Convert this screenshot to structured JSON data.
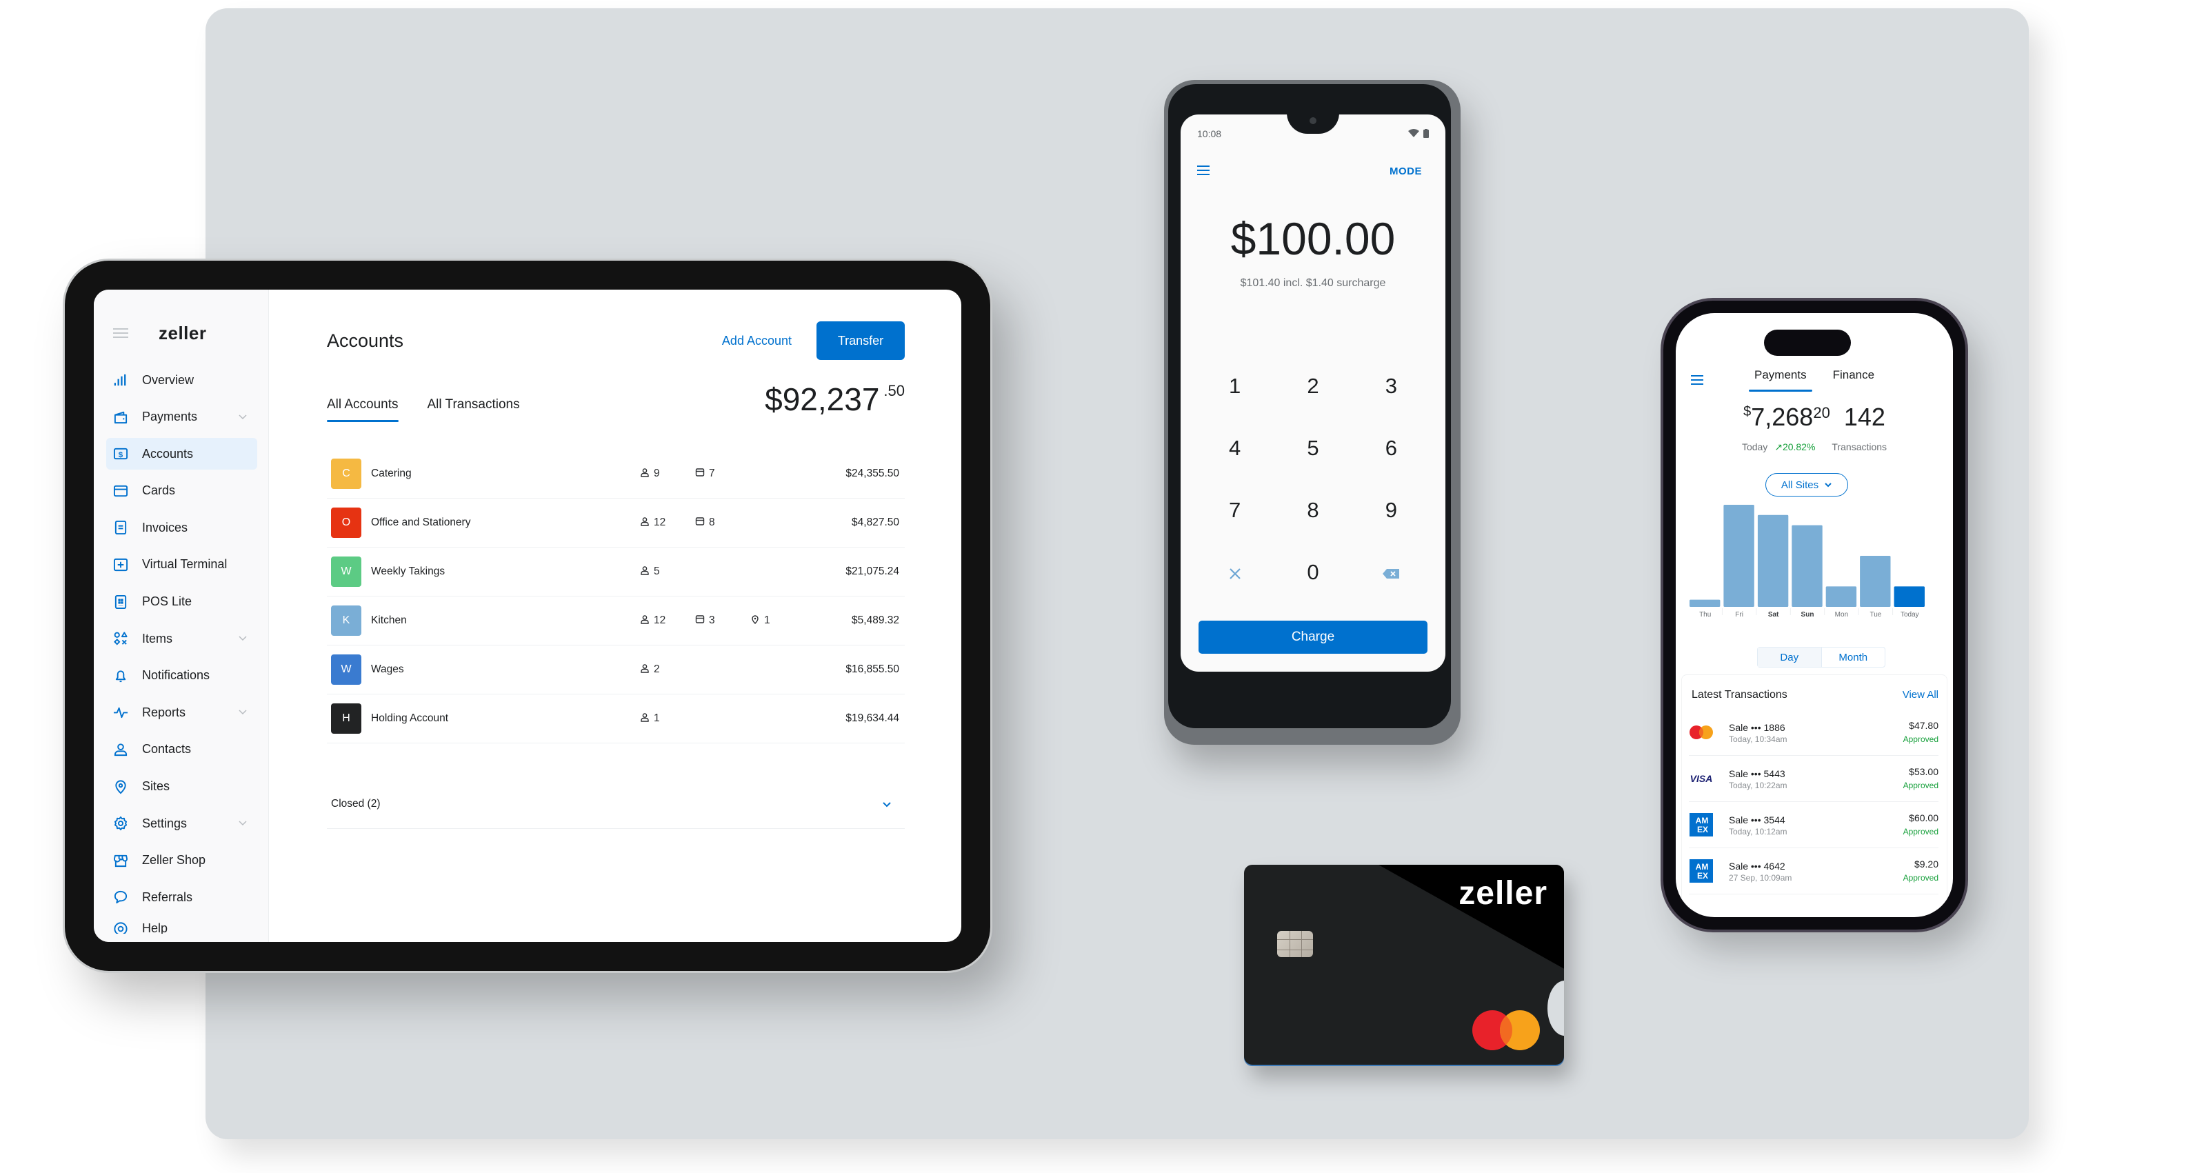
{
  "colors": {
    "brand_blue": "#0071ce",
    "success_green": "#18a03c",
    "chart_bar": "#7aaed6",
    "chart_bar_today": "#0071ce"
  },
  "tablet": {
    "brand": "zeller",
    "sidebar": {
      "items": [
        {
          "label": "Overview",
          "icon": "bar-chart-icon",
          "expandable": false,
          "active": false
        },
        {
          "label": "Payments",
          "icon": "wallet-icon",
          "expandable": true,
          "active": false
        },
        {
          "label": "Accounts",
          "icon": "dollar-account-icon",
          "expandable": false,
          "active": true
        },
        {
          "label": "Cards",
          "icon": "credit-card-icon",
          "expandable": false,
          "active": false
        },
        {
          "label": "Invoices",
          "icon": "invoice-icon",
          "expandable": false,
          "active": false
        },
        {
          "label": "Virtual Terminal",
          "icon": "plus-square-icon",
          "expandable": false,
          "active": false
        },
        {
          "label": "POS Lite",
          "icon": "pos-icon",
          "expandable": false,
          "active": false
        },
        {
          "label": "Items",
          "icon": "shapes-icon",
          "expandable": true,
          "active": false
        },
        {
          "label": "Notifications",
          "icon": "bell-icon",
          "expandable": false,
          "active": false
        },
        {
          "label": "Reports",
          "icon": "pulse-icon",
          "expandable": true,
          "active": false
        },
        {
          "label": "Contacts",
          "icon": "user-icon",
          "expandable": false,
          "active": false
        },
        {
          "label": "Sites",
          "icon": "location-pin-icon",
          "expandable": false,
          "active": false
        },
        {
          "label": "Settings",
          "icon": "gear-icon",
          "expandable": true,
          "active": false
        },
        {
          "label": "Zeller Shop",
          "icon": "shop-icon",
          "expandable": false,
          "active": false
        },
        {
          "label": "Referrals",
          "icon": "chat-bubble-icon",
          "expandable": false,
          "active": false
        },
        {
          "label": "Help",
          "icon": "help-icon",
          "expandable": false,
          "active": false
        }
      ]
    },
    "main": {
      "title": "Accounts",
      "add_account_label": "Add Account",
      "transfer_label": "Transfer",
      "tabs": [
        {
          "label": "All Accounts",
          "active": true
        },
        {
          "label": "All Transactions",
          "active": false
        }
      ],
      "total_dollars": "$92,237",
      "total_cents": ".50",
      "accounts": [
        {
          "initial": "C",
          "name": "Catering",
          "color": "#f5b942",
          "users": "9",
          "cards": "7",
          "sites": null,
          "balance": "$24,355.50"
        },
        {
          "initial": "O",
          "name": "Office and Stationery",
          "color": "#e63312",
          "users": "12",
          "cards": "8",
          "sites": null,
          "balance": "$4,827.50"
        },
        {
          "initial": "W",
          "name": "Weekly Takings",
          "color": "#5ccb84",
          "users": "5",
          "cards": null,
          "sites": null,
          "balance": "$21,075.24"
        },
        {
          "initial": "K",
          "name": "Kitchen",
          "color": "#7aaed6",
          "users": "12",
          "cards": "3",
          "sites": "1",
          "balance": "$5,489.32"
        },
        {
          "initial": "W",
          "name": "Wages",
          "color": "#3a7bd0",
          "users": "2",
          "cards": null,
          "sites": null,
          "balance": "$16,855.50"
        },
        {
          "initial": "H",
          "name": "Holding Account",
          "color": "#222324",
          "users": "1",
          "cards": null,
          "sites": null,
          "balance": "$19,634.44"
        }
      ],
      "closed_label": "Closed (2)"
    }
  },
  "terminal": {
    "time": "10:08",
    "mode_label": "MODE",
    "amount": "$100.00",
    "surcharge_text": "$101.40 incl. $1.40 surcharge",
    "keys": [
      "1",
      "2",
      "3",
      "4",
      "5",
      "6",
      "7",
      "8",
      "9",
      "clear",
      "0",
      "backspace"
    ],
    "charge_label": "Charge"
  },
  "phone": {
    "tabs": [
      {
        "label": "Payments",
        "active": true
      },
      {
        "label": "Finance",
        "active": false
      }
    ],
    "revenue_currency": "$",
    "revenue_whole": "7,268",
    "revenue_cents": "20",
    "transactions_count": "142",
    "today_label": "Today",
    "change_pct": "20.82%",
    "transactions_label": "Transactions",
    "site_filter": "All Sites",
    "period_options": [
      {
        "label": "Day",
        "active": true
      },
      {
        "label": "Month",
        "active": false
      }
    ],
    "latest_title": "Latest Transactions",
    "view_all_label": "View All",
    "transactions": [
      {
        "brand": "mastercard",
        "title": "Sale ••• 1886",
        "time": "Today, 10:34am",
        "amount": "$47.80",
        "status": "Approved"
      },
      {
        "brand": "visa",
        "title": "Sale ••• 5443",
        "time": "Today, 10:22am",
        "amount": "$53.00",
        "status": "Approved"
      },
      {
        "brand": "amex",
        "title": "Sale ••• 3544",
        "time": "Today, 10:12am",
        "amount": "$60.00",
        "status": "Approved"
      },
      {
        "brand": "amex",
        "title": "Sale ••• 4642",
        "time": "27 Sep, 10:09am",
        "amount": "$9.20",
        "status": "Approved"
      }
    ]
  },
  "chart_data": {
    "type": "bar",
    "title": "",
    "xlabel": "",
    "ylabel": "",
    "categories": [
      "Thu",
      "Fri",
      "Sat",
      "Sun",
      "Mon",
      "Tue",
      "Today"
    ],
    "bold_categories": [
      "Sat",
      "Sun"
    ],
    "values": [
      7,
      100,
      90,
      80,
      20,
      50,
      20
    ],
    "highlight_index": 6,
    "ylim": [
      0,
      100
    ],
    "grid": false
  },
  "card": {
    "brand": "zeller",
    "network": "mastercard"
  }
}
